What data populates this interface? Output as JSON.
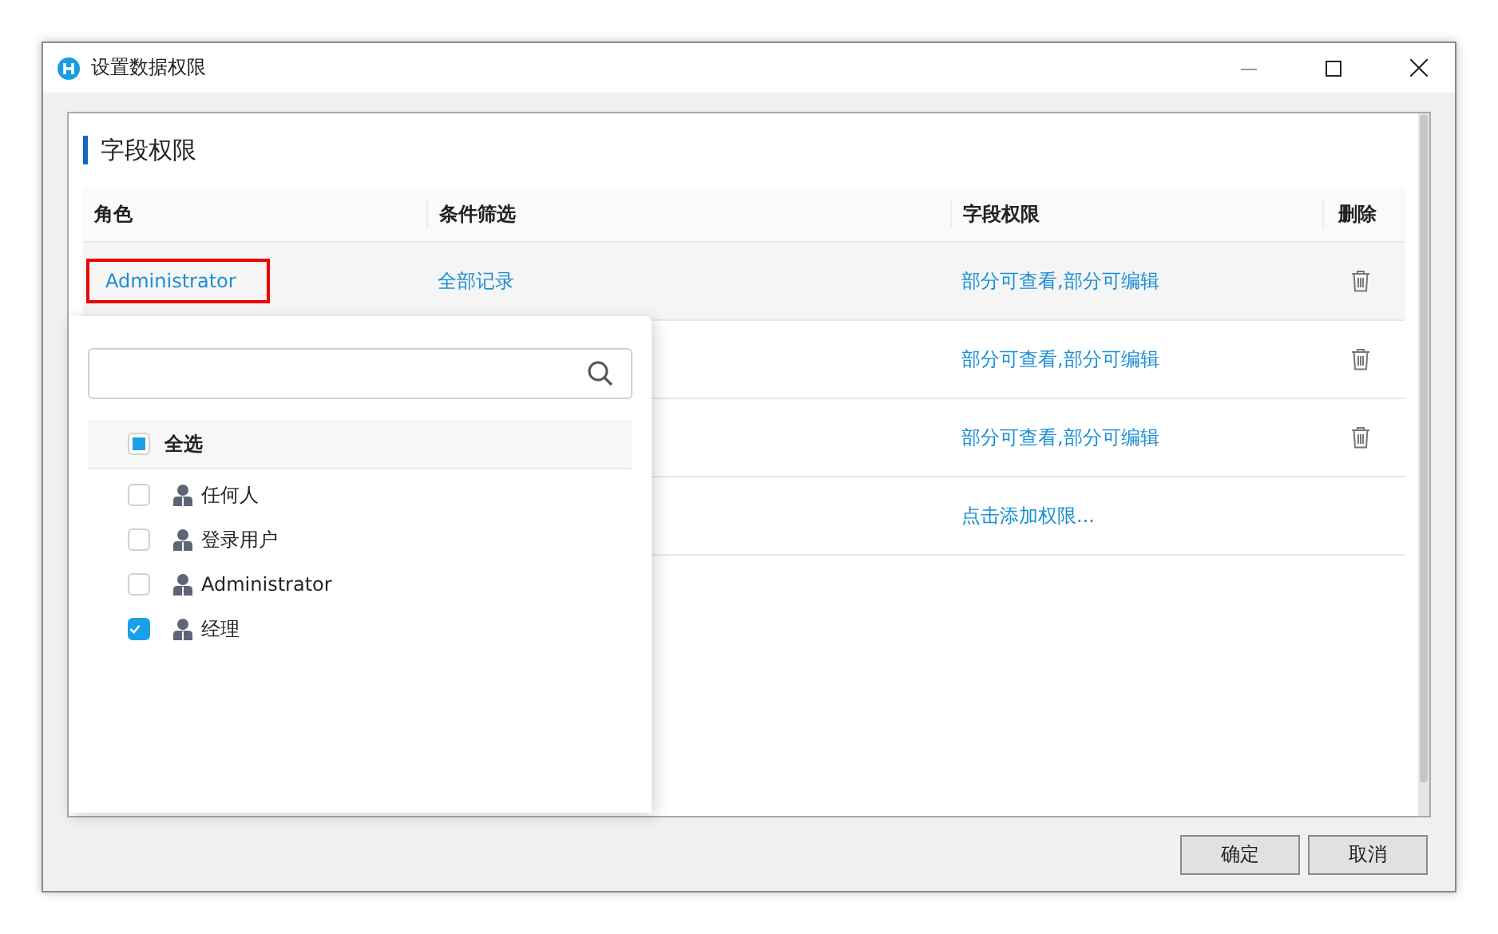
{
  "window": {
    "title": "设置数据权限"
  },
  "panel": {
    "title": "字段权限"
  },
  "table": {
    "columns": [
      "角色",
      "条件筛选",
      "字段权限",
      "删除"
    ],
    "rows": [
      {
        "role": "Administrator",
        "condition": "全部记录",
        "fields": "部分可查看,部分可编辑",
        "highlighted": true,
        "deletable": true
      },
      {
        "fields": "部分可查看,部分可编辑",
        "highlighted": false,
        "deletable": true
      },
      {
        "fields": "部分可查看,部分可编辑",
        "highlighted": false,
        "deletable": true
      },
      {
        "fields": "点击添加权限...",
        "highlighted": false,
        "deletable": false
      }
    ]
  },
  "role_picker": {
    "select_all": {
      "label": "全选",
      "indeterminate": true
    },
    "items": [
      {
        "label": "任何人",
        "checked": false
      },
      {
        "label": "登录用户",
        "checked": false
      },
      {
        "label": "Administrator",
        "checked": false
      },
      {
        "label": "经理",
        "checked": true
      }
    ]
  },
  "buttons": [
    "确定",
    "取消"
  ]
}
